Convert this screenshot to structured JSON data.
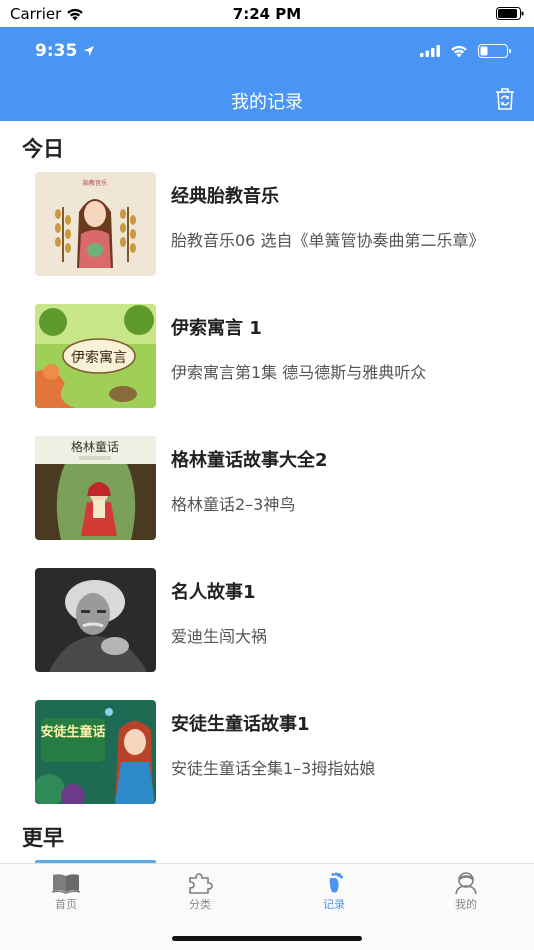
{
  "status": {
    "carrier": "Carrier",
    "time": "7:24 PM"
  },
  "inner_status": {
    "time": "9:35"
  },
  "header": {
    "title": "我的记录"
  },
  "sections": {
    "today": "今日",
    "earlier": "更早"
  },
  "items": [
    {
      "title": "经典胎教音乐",
      "subtitle": "胎教音乐06 选自《单簧管协奏曲第二乐章》",
      "thumb_text": "胎教音乐"
    },
    {
      "title": "伊索寓言 1",
      "subtitle": "伊索寓言第1集 德马德斯与雅典听众",
      "thumb_text": "伊索寓言"
    },
    {
      "title": "格林童话故事大全2",
      "subtitle": "格林童话2–3神鸟",
      "thumb_text": "格林童话"
    },
    {
      "title": "名人故事1",
      "subtitle": "爱迪生闯大祸",
      "thumb_text": ""
    },
    {
      "title": "安徒生童话故事1",
      "subtitle": "安徒生童话全集1–3拇指姑娘",
      "thumb_text": "安徒生童话"
    }
  ],
  "tabs": [
    {
      "label": "首页",
      "icon": "book-icon"
    },
    {
      "label": "分类",
      "icon": "puzzle-icon"
    },
    {
      "label": "记录",
      "icon": "footprint-icon"
    },
    {
      "label": "我的",
      "icon": "user-icon"
    }
  ],
  "colors": {
    "primary": "#4a95f3",
    "tab_inactive": "#888888"
  }
}
